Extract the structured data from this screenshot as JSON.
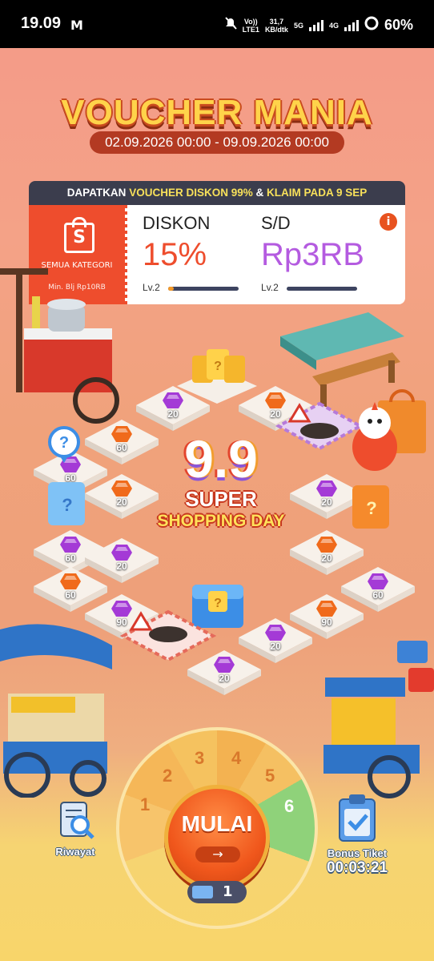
{
  "status_bar": {
    "time": "19.09",
    "mail_icon": "M",
    "volte_top": "Vo))",
    "volte_bottom": "LTE1",
    "speed_top": "31,7",
    "speed_bottom": "KB/dtk",
    "net_5g": "5G",
    "net_4g": "4G",
    "battery": "60%"
  },
  "header": {
    "title": "VOUCHER MANIA",
    "dates": "02.09.2026 00:00 - 09.09.2026 00:00"
  },
  "promo": {
    "prefix": "DAPATKAN",
    "highlight1": "VOUCHER DISKON 99%",
    "amp": "&",
    "highlight2": "KLAIM PADA 9 SEP"
  },
  "voucher": {
    "logo_letter": "S",
    "category": "SEMUA KATEGORI",
    "min_spend": "Min. Blj Rp10RB",
    "diskon_label": "DISKON",
    "diskon_value": "15%",
    "diskon_level": "Lv.2",
    "diskon_progress": 0.08,
    "sd_label": "S/D",
    "sd_value": "Rp3RB",
    "sd_level": "Lv.2",
    "sd_progress": 0.0,
    "info_icon": "i"
  },
  "board": {
    "mystery": "?",
    "tiles": [
      "20",
      "20",
      "60",
      "60",
      "20",
      "20",
      "60",
      "20",
      "20",
      "20",
      "60",
      "60",
      "90",
      "90",
      "20"
    ]
  },
  "center_logo": {
    "number": "9.9",
    "line1": "SUPER",
    "line2": "SHOPPING DAY"
  },
  "wheel": {
    "numbers": [
      "1",
      "2",
      "3",
      "4",
      "5",
      "6"
    ]
  },
  "controls": {
    "start_label": "MULAI",
    "start_arrow": "→",
    "tickets": "1",
    "history_label": "Riwayat",
    "bonus_label": "Bonus Tiket",
    "bonus_timer": "00:03:21"
  },
  "colors": {
    "shopee": "#ee4d2d",
    "diskon": "#ee4d2d",
    "sd": "#b45be0",
    "gem_purple": "#a43ad6",
    "gem_orange": "#f06a1b"
  }
}
